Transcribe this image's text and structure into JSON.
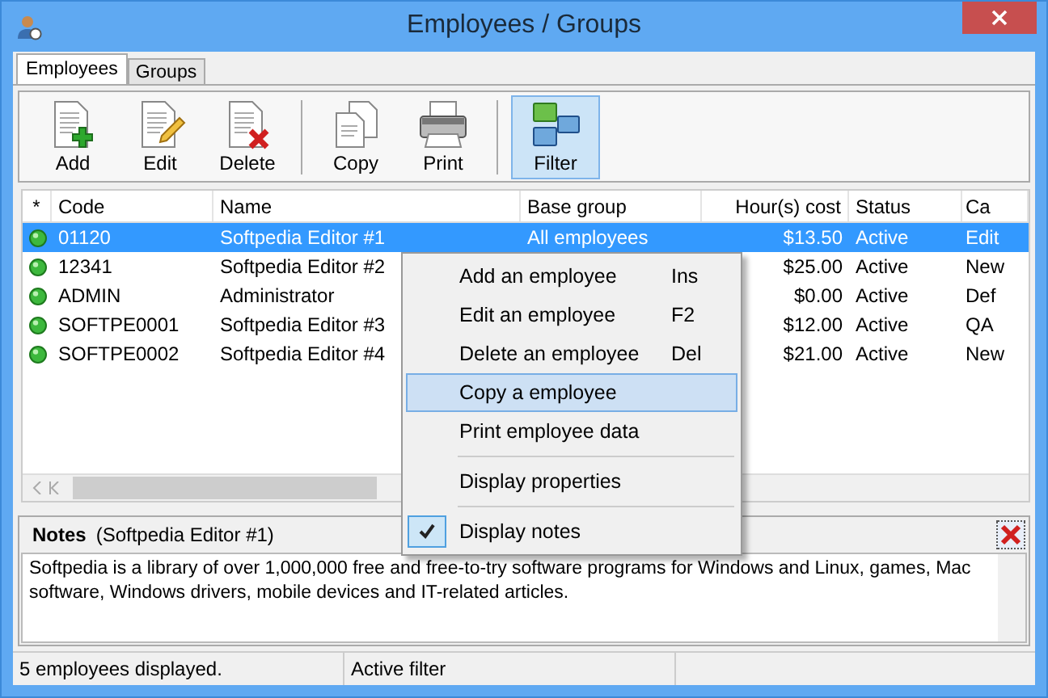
{
  "window": {
    "title": "Employees / Groups"
  },
  "tabs": [
    {
      "label": "Employees",
      "selected": true
    },
    {
      "label": "Groups",
      "selected": false
    }
  ],
  "toolbar": {
    "groups": [
      [
        {
          "label": "Add",
          "selected": false
        },
        {
          "label": "Edit",
          "selected": false
        },
        {
          "label": "Delete",
          "selected": false
        }
      ],
      [
        {
          "label": "Copy",
          "selected": false
        },
        {
          "label": "Print",
          "selected": false
        }
      ],
      [
        {
          "label": "Filter",
          "selected": true
        }
      ]
    ]
  },
  "table": {
    "columns": [
      "*",
      "Code",
      "Name",
      "Base group",
      "Hour(s) cost",
      "Status",
      "Ca"
    ],
    "rows": [
      {
        "code": "01120",
        "name": "Softpedia Editor #1",
        "base_group": "All employees",
        "cost": "$13.50",
        "status": "Active",
        "column_7": "Edit",
        "selected": true
      },
      {
        "code": "12341",
        "name": "Softpedia Editor #2",
        "cost": "$25.00",
        "status": "Active",
        "column_7": "New",
        "selected": false
      },
      {
        "code": "ADMIN",
        "name": "Administrator",
        "cost": "$0.00",
        "status": "Active",
        "column_7": "Def",
        "selected": false
      },
      {
        "code": "SOFTPE0001",
        "name": "Softpedia Editor #3",
        "cost": "$12.00",
        "status": "Active",
        "column_7": "QA",
        "selected": false
      },
      {
        "code": "SOFTPE0002",
        "name": "Softpedia Editor #4",
        "cost": "$21.00",
        "status": "Active",
        "column_7": "New",
        "selected": false
      }
    ]
  },
  "context_menu": {
    "groups": [
      [
        {
          "label": "Add an employee",
          "shortcut": "Ins",
          "selected": false,
          "checked": false
        },
        {
          "label": "Edit an employee",
          "shortcut": "F2",
          "selected": false,
          "checked": false
        },
        {
          "label": "Delete an employee",
          "shortcut": "Del",
          "selected": false,
          "checked": false
        },
        {
          "label": "Copy a employee",
          "selected": true,
          "checked": false
        },
        {
          "label": "Print employee data",
          "selected": false,
          "checked": false
        }
      ],
      [
        {
          "label": "Display properties",
          "selected": false,
          "checked": false
        }
      ],
      [
        {
          "label": "Display notes",
          "selected": false,
          "checked": true
        }
      ]
    ]
  },
  "notes": {
    "title": "Notes",
    "subtitle": "(Softpedia Editor #1)",
    "text": "Softpedia is a library of over 1,000,000 free and free-to-try software programs for Windows and Linux, games, Mac software, Windows drivers, mobile devices and IT-related articles."
  },
  "status_bar": [
    "5 employees displayed.",
    "Active filter"
  ]
}
